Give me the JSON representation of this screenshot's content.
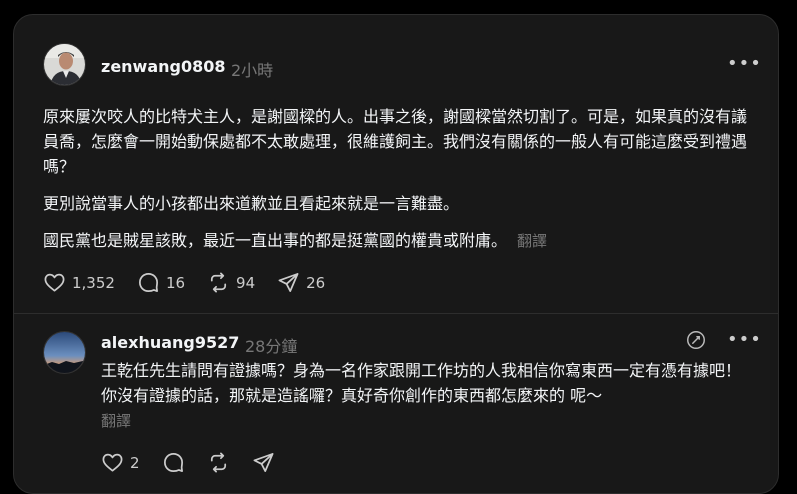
{
  "post": {
    "username": "zenwang0808",
    "time": "2小時",
    "paragraphs": [
      "原來屢次咬人的比特犬主人，是謝國樑的人。出事之後，謝國樑當然切割了。可是，如果真的沒有議員喬，怎麼會一開始動保處都不太敢處理，很維護飼主。我們沒有關係的一般人有可能這麼受到禮遇嗎？",
      "更別說當事人的小孩都出來道歉並且看起來就是一言難盡。",
      "國民黨也是賊星該敗，最近一直出事的都是挺黨國的權貴或附庸。"
    ],
    "translate": "翻譯",
    "likes": "1,352",
    "comments": "16",
    "reposts": "94",
    "shares": "26"
  },
  "reply": {
    "username": "alexhuang9527",
    "time": "28分鐘",
    "text": "王乾任先生請問有證據嗎？身為一名作家跟開工作坊的人我相信你寫東西一定有憑有據吧！ 你沒有證據的話，那就是造謠囉？真好奇你創作的東西都怎麼來的 呢～",
    "translate": "翻譯",
    "likes": "2"
  },
  "more_icon": "more-horizontal-icon",
  "colors": {
    "card_bg": "#181818",
    "page_bg": "#000000",
    "muted": "#777777",
    "text": "#f3f5f7"
  }
}
